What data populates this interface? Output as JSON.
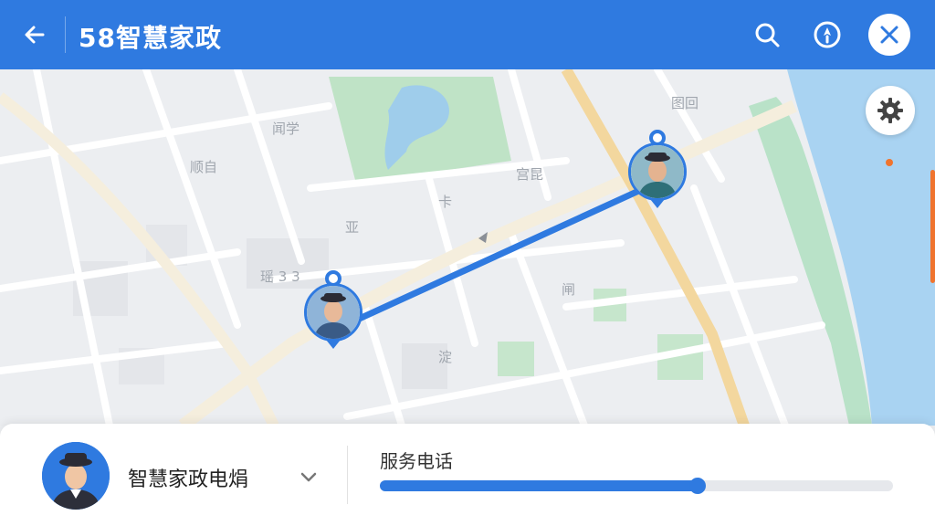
{
  "header": {
    "title": "58智慧家政",
    "back_icon": "arrow-left-icon",
    "search_icon": "search-icon",
    "compass_icon": "compass-icon",
    "close_icon": "close-icon"
  },
  "map": {
    "labels": [
      "顺自",
      "闻学",
      "宫昆",
      "瑶 3 3",
      "亚",
      "卡",
      "图回",
      "闸",
      "淀"
    ],
    "route_color": "#2f7ae0",
    "settings_icon": "gear-icon"
  },
  "panel": {
    "provider_name": "智慧家政电焆",
    "section_label": "服务电话",
    "progress": 0.62,
    "chevron_icon": "chevron-down-icon"
  },
  "colors": {
    "brand": "#2f7ae0",
    "accent": "#f0742e"
  }
}
